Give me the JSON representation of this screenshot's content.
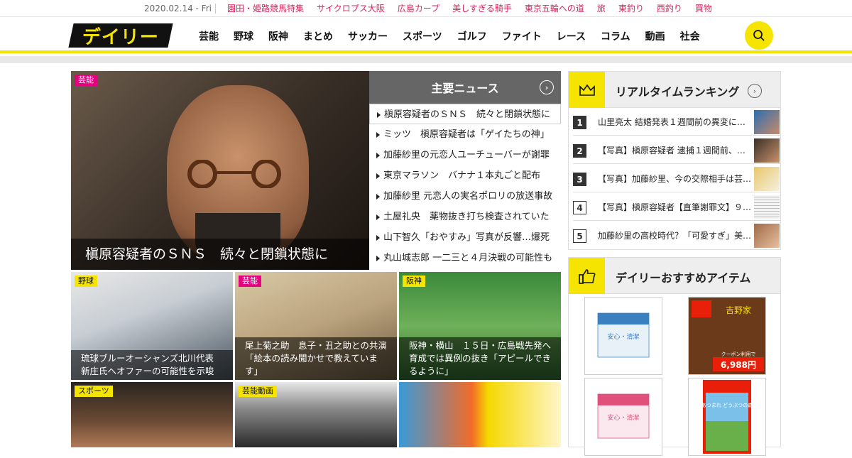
{
  "topbar": {
    "date": "2020.02.14 - Fri",
    "links": [
      "園田・姫路競馬特集",
      "サイクロプス大阪",
      "広島カープ",
      "美しすぎる騎手",
      "東京五輪への道",
      "旅",
      "東釣り",
      "西釣り",
      "買物"
    ]
  },
  "header": {
    "logo": "デイリー",
    "nav": [
      "芸能",
      "野球",
      "阪神",
      "まとめ",
      "サッカー",
      "スポーツ",
      "ゴルフ",
      "ファイト",
      "レース",
      "コラム",
      "動画",
      "社会"
    ]
  },
  "hero": {
    "tag": "芸能",
    "caption": "槇原容疑者のＳＮＳ　続々と閉鎖状態に"
  },
  "main_news": {
    "title": "主要ニュース",
    "items": [
      "槇原容疑者のＳＮＳ　続々と閉鎖状態に",
      "ミッツ　槇原容疑者は「ゲイたちの神」",
      "加藤紗里の元恋人ユーチューバーが謝罪",
      "東京マラソン　バナナ１本丸ごと配布",
      "加藤紗里 元恋人の実名ポロリの放送事故",
      "土屋礼央　薬物抜き打ち検査されていた",
      "山下智久「おやすみ」写真が反響…爆死",
      "丸山城志郎 一二三と４月決戦の可能性も"
    ]
  },
  "cards": [
    {
      "tag": "野球",
      "caption": "琉球ブルーオーシャンズ北川代表　新庄氏へオファーの可能性を示唆"
    },
    {
      "tag": "芸能",
      "caption": "尾上菊之助　息子・丑之助との共演「絵本の読み聞かせで教えています」"
    },
    {
      "tag": "阪神",
      "caption": "阪神・横山　１５日・広島戦先発へ　育成では異例の抜き「アピールできるように」"
    },
    {
      "tag": "スポーツ",
      "caption": ""
    },
    {
      "tag": "芸能動画",
      "caption": ""
    }
  ],
  "ranking": {
    "title": "リアルタイムランキング",
    "items": [
      {
        "num": "1",
        "text": "山里亮太 結婚発表１週間前の異変に…"
      },
      {
        "num": "2",
        "text": "【写真】槇原容疑者 逮捕１週間前、…"
      },
      {
        "num": "3",
        "text": "【写真】加藤紗里、今の交際相手は芸…"
      },
      {
        "num": "4",
        "text": "【写真】槇原容疑者【直筆謝罪文】９…"
      },
      {
        "num": "5",
        "text": "加藤紗里の高校時代？「可愛すぎ」美…"
      }
    ]
  },
  "recommend": {
    "title": "デイリーおすすめアイテム",
    "products": [
      {
        "label": "安心・清潔"
      },
      {
        "label": "吉野家",
        "price": "6,988円",
        "badge": "クーポン利用で"
      },
      {
        "label": "安心・清潔"
      },
      {
        "label": "あつまれ どうぶつの森"
      }
    ]
  },
  "colors": {
    "accent": "#f5e400",
    "pink": "#d8245b",
    "tag_pink": "#e4007f"
  }
}
